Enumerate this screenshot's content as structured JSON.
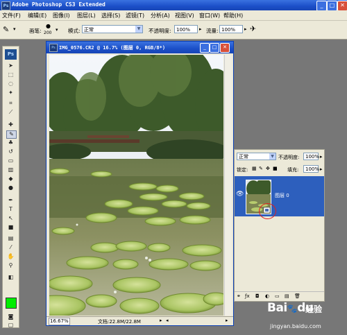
{
  "app": {
    "title": "Adobe Photoshop CS3 Extended",
    "logo": "Ps"
  },
  "menu": {
    "items": [
      "文件(F)",
      "编辑(E)",
      "图像(I)",
      "图层(L)",
      "选择(S)",
      "滤镜(T)",
      "分析(A)",
      "视图(V)",
      "窗口(W)",
      "帮助(H)"
    ]
  },
  "options": {
    "brush_label": "画笔:",
    "brush_size": "200",
    "mode_label": "模式:",
    "mode_value": "正常",
    "opacity_label": "不透明度:",
    "opacity_value": "100%",
    "flow_label": "流量:",
    "flow_value": "100%"
  },
  "document": {
    "title": "IMG_0576.CR2 @ 16.7% (图层 0, RGB/8*)",
    "zoom": "16.67%",
    "status": "文档:22.8M/22.8M"
  },
  "layers_panel": {
    "blend_mode": "正常",
    "opacity_label": "不透明度:",
    "opacity_value": "100%",
    "lock_label": "锁定:",
    "fill_label": "填充:",
    "fill_value": "100%",
    "layer_name": "图层 0"
  },
  "colors": {
    "foreground": "#00ee00",
    "layer_selected": "#2d5fbd",
    "title_blue": "#1b4fc8"
  },
  "watermark": {
    "logo": "Bai",
    "logo_tail": "du",
    "text": "经验",
    "url": "jingyan.baidu.com"
  }
}
